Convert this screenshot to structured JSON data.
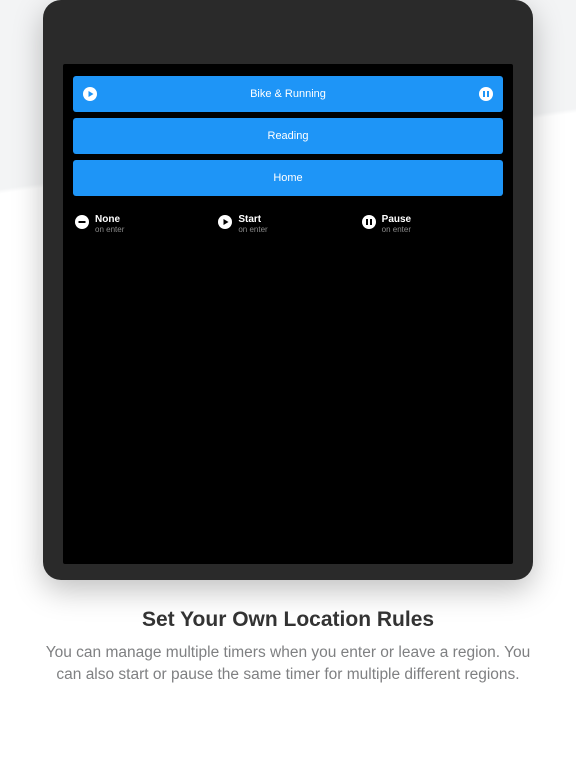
{
  "accent": "#1e95f7",
  "timers": [
    {
      "label": "Bike & Running",
      "left_icon": "play",
      "right_icon": "pause"
    },
    {
      "label": "Reading",
      "left_icon": null,
      "right_icon": null
    },
    {
      "label": "Home",
      "left_icon": null,
      "right_icon": null
    }
  ],
  "legend": [
    {
      "icon": "minus",
      "title": "None",
      "sub": "on enter"
    },
    {
      "icon": "play",
      "title": "Start",
      "sub": "on enter"
    },
    {
      "icon": "pause",
      "title": "Pause",
      "sub": "on enter"
    }
  ],
  "caption": {
    "heading": "Set Your Own Location Rules",
    "body": "You can manage multiple timers when you enter or leave a region. You can also start or pause the same timer for multiple different regions."
  }
}
